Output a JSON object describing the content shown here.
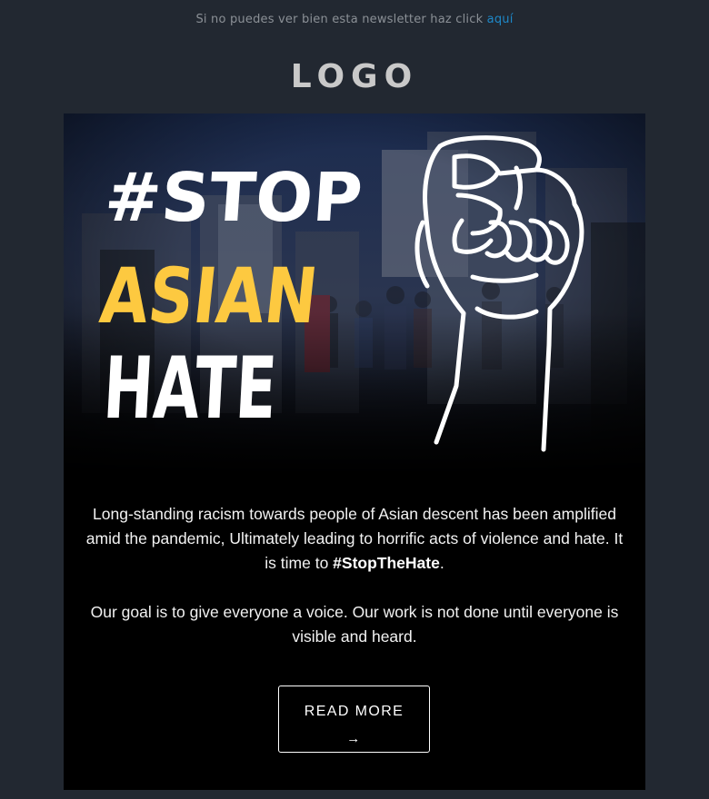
{
  "preheader": {
    "text": "Si no puedes ver bien esta newsletter haz click ",
    "link_label": "aquí"
  },
  "logo": {
    "text": "LOGO"
  },
  "hero": {
    "line1": "#STOP",
    "line2": "ASIAN",
    "line3": "HATE",
    "colors": {
      "white": "#ffffff",
      "yellow": "#fdc940"
    }
  },
  "body": {
    "paragraph1_before": "Long-standing racism towards people of Asian descent has been amplified amid the pandemic, Ultimately leading to horrific acts of violence and hate. It is time to ",
    "paragraph1_strong": "#StopTheHate",
    "paragraph1_after": ".",
    "paragraph2": "Our goal is to give everyone a voice. Our work is not done until everyone is visible and heard."
  },
  "cta": {
    "label": "READ MORE",
    "arrow": "→"
  },
  "colors": {
    "page_bg": "#222831",
    "card_bg": "#000000",
    "link": "#1e88c8",
    "logo": "#c9c9c9"
  }
}
